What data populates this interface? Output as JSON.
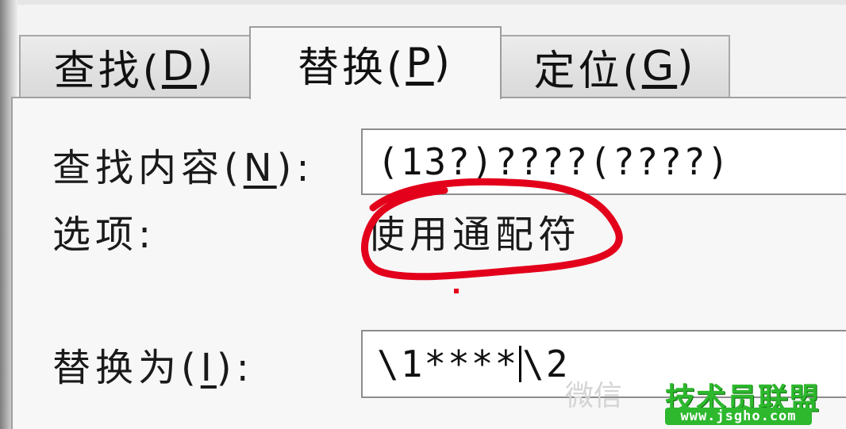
{
  "tabs": [
    {
      "label": "查找(",
      "key": "D",
      "close": ")",
      "active": false
    },
    {
      "label": "替换(",
      "key": "P",
      "close": ")",
      "active": true
    },
    {
      "label": "定位(",
      "key": "G",
      "close": ")",
      "active": false
    }
  ],
  "find": {
    "label_pre": "查找内容(",
    "label_key": "N",
    "label_post": "):",
    "value": "(13?)????(????)"
  },
  "options": {
    "label": "选项:",
    "value": "使用通配符"
  },
  "replace": {
    "label_pre": "替换为(",
    "label_key": "I",
    "label_post": "):",
    "value_before_caret": "\\1****",
    "value_after_caret": "\\2"
  },
  "watermark": {
    "faded_text": "微信",
    "logo_text": "技术员联盟",
    "url": "www.jsgho.com"
  },
  "colors": {
    "annotation": "#e3001b",
    "watermark_green": "#2db82d"
  }
}
